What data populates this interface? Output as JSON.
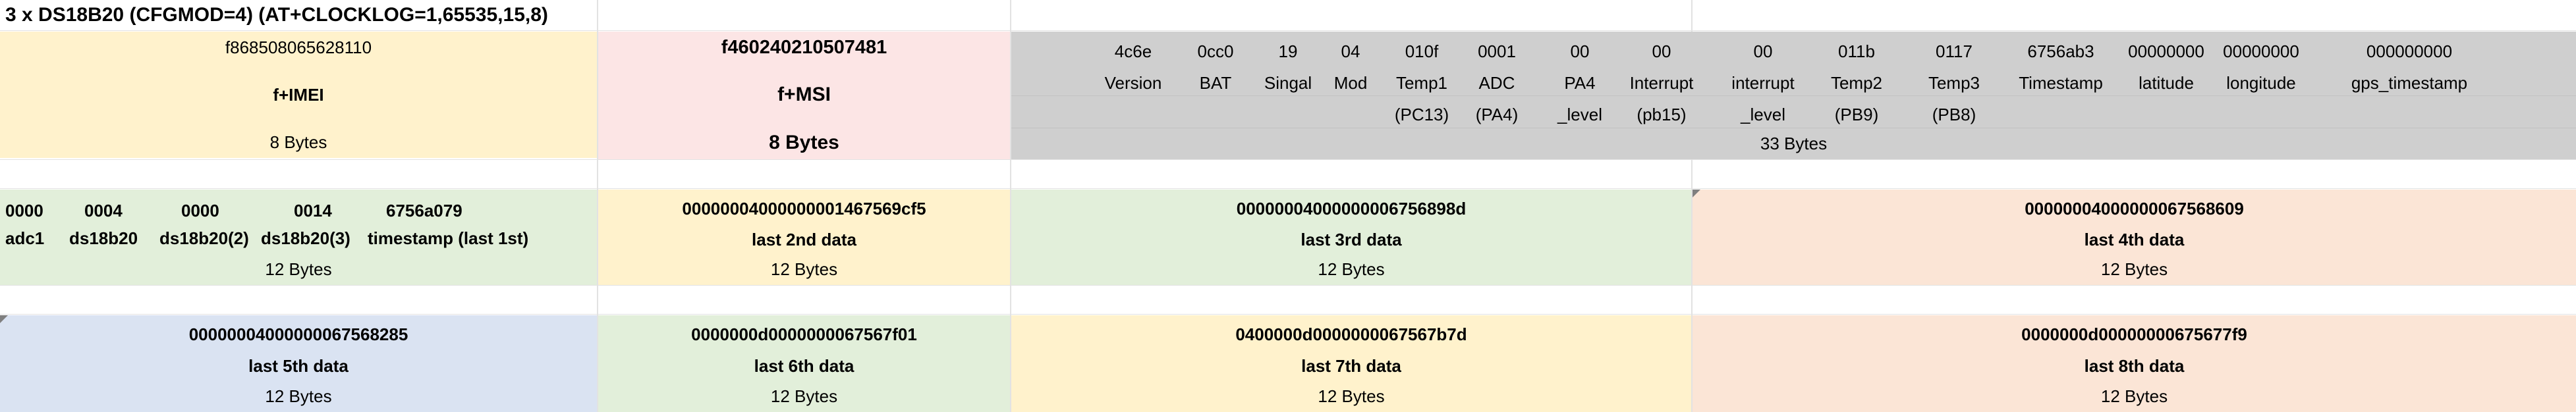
{
  "title": "3 x DS18B20  (CFGMOD=4)  (AT+CLOCKLOG=1,65535,15,8)",
  "header": {
    "imei": {
      "value": "f868508065628110",
      "label": "f+IMEI",
      "size": "8 Bytes"
    },
    "imsi": {
      "value": "f460240210507481",
      "label": "f+MSI",
      "size": "8 Bytes"
    },
    "fields": [
      {
        "value": "4c6e",
        "name": "Version",
        "sub": ""
      },
      {
        "value": "0cc0",
        "name": "BAT",
        "sub": ""
      },
      {
        "value": "19",
        "name": "Singal",
        "sub": ""
      },
      {
        "value": "04",
        "name": "Mod",
        "sub": ""
      },
      {
        "value": "010f",
        "name": "Temp1",
        "sub": "(PC13)"
      },
      {
        "value": "0001",
        "name": "ADC",
        "sub": "(PA4)"
      },
      {
        "value": "00",
        "name": "PA4",
        "sub": "_level"
      },
      {
        "value": "00",
        "name": "Interrupt",
        "sub": "(pb15)"
      },
      {
        "value": "00",
        "name": "interrupt",
        "sub": "_level"
      },
      {
        "value": "011b",
        "name": "Temp2",
        "sub": "(PB9)"
      },
      {
        "value": "0117",
        "name": "Temp3",
        "sub": "(PB8)"
      },
      {
        "value": "6756ab3",
        "name": "Timestamp",
        "sub": ""
      },
      {
        "value": "00000000",
        "name": "latitude",
        "sub": ""
      },
      {
        "value": "00000000",
        "name": "longitude",
        "sub": ""
      },
      {
        "value": "000000000",
        "name": "gps_timestamp",
        "sub": ""
      }
    ],
    "fields_size": "33 Bytes"
  },
  "first_data": {
    "values": [
      "0000",
      "0004",
      "0000",
      "0014",
      "6756a079"
    ],
    "labels": [
      "adc1",
      "ds18b20",
      "ds18b20(2)",
      "ds18b20(3)",
      "timestamp (last 1st)"
    ],
    "size": "12 Bytes"
  },
  "data_blocks": [
    {
      "value": "00000004000000001467569cf5",
      "label": "last 2nd data",
      "size": "12 Bytes"
    },
    {
      "value": "00000004000000006756898d",
      "label": "last 3rd data",
      "size": "12 Bytes"
    },
    {
      "value": "00000004000000067568609",
      "label": "last 4th data",
      "size": "12 Bytes"
    },
    {
      "value": "00000004000000067568285",
      "label": "last 5th data",
      "size": "12 Bytes"
    },
    {
      "value": "0000000d0000000067567f01",
      "label": "last 6th data",
      "size": "12 Bytes"
    },
    {
      "value": "0400000d0000000067567b7d",
      "label": "last 7th data",
      "size": "12 Bytes"
    },
    {
      "value": "0000000d00000000675677f9",
      "label": "last 8th data",
      "size": "12 Bytes"
    }
  ],
  "colors": {
    "yellow": "#fff2cc",
    "pink": "#fce5e5",
    "gray": "#cfcfcf",
    "green": "#e2efda",
    "orange": "#fbe5d6",
    "blue": "#dae3f2"
  }
}
